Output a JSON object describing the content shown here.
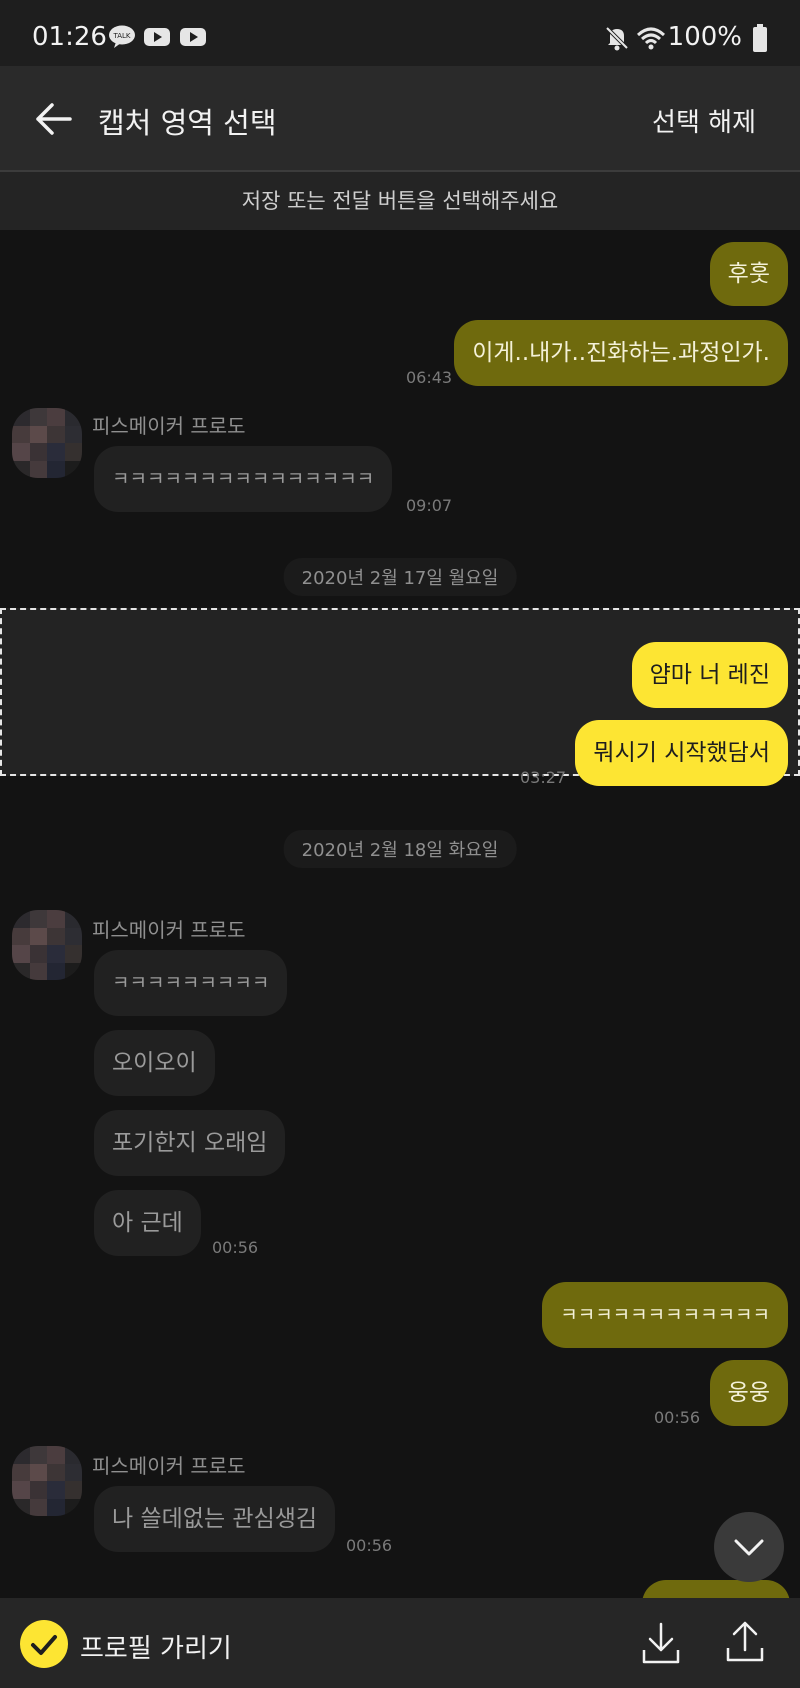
{
  "status_bar": {
    "time": "01:26",
    "battery": "100%"
  },
  "app_bar": {
    "title": "캡처 영역 선택",
    "deselect_label": "선택 해제"
  },
  "banner": "저장 또는 전달 버튼을 선택해주세요",
  "messages": {
    "m1": "후훗",
    "m2": "이게..내가..진화하는.과정인가.",
    "m2_time": "06:43",
    "sender1": "피스메이커 프로도",
    "m3": "ㅋㅋㅋㅋㅋㅋㅋㅋㅋㅋㅋㅋㅋㅋㅋ",
    "m3_time": "09:07",
    "date1": "2020년 2월 17일 월요일",
    "m4": "얌마 너 레진",
    "m5": "뭐시기 시작했담서",
    "m5_time": "03:27",
    "date2": "2020년 2월 18일 화요일",
    "sender2": "피스메이커 프로도",
    "m6": "ㅋㅋㅋㅋㅋㅋㅋㅋㅋ",
    "m7": "오이오이",
    "m8": "포기한지 오래임",
    "m9": "아 근데",
    "m9_time": "00:56",
    "m10": "ㅋㅋㅋㅋㅋㅋㅋㅋㅋㅋㅋㅋ",
    "m11": "웅웅",
    "m11_time": "00:56",
    "sender3": "피스메이커 프로도",
    "m12": "나 쓸데없는 관심생김",
    "m12_time": "00:56"
  },
  "bottom_bar": {
    "hide_profile_label": "프로필 가리기"
  },
  "colors": {
    "accent_yellow": "#fde533",
    "dim_yellow": "#6f6a0d",
    "background": "#131313"
  },
  "icons": [
    "kakaotalk-icon",
    "youtube-icon",
    "mute-icon",
    "wifi-icon",
    "battery-icon",
    "back-arrow-icon",
    "chevron-down-icon",
    "check-icon",
    "download-icon",
    "share-icon"
  ]
}
